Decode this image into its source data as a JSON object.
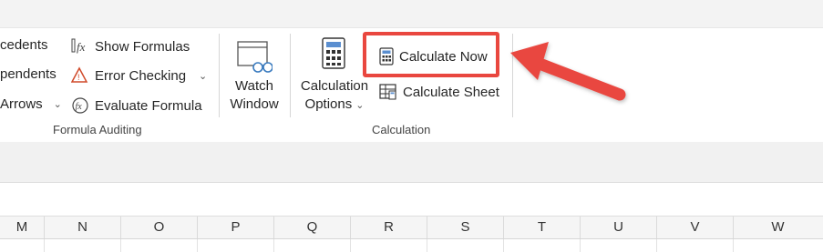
{
  "ribbon": {
    "formula_auditing": {
      "items": {
        "trace_precedents": "cedents",
        "trace_dependents": "pendents",
        "remove_arrows": "Arrows",
        "show_formulas": "Show Formulas",
        "error_checking": "Error Checking",
        "evaluate_formula": "Evaluate Formula"
      },
      "label": "Formula Auditing"
    },
    "watch_window": {
      "line1": "Watch",
      "line2": "Window"
    },
    "calculation": {
      "options_line1": "Calculation",
      "options_line2": "Options",
      "calculate_now": "Calculate Now",
      "calculate_sheet": "Calculate Sheet",
      "label": "Calculation"
    }
  },
  "columns": [
    "M",
    "N",
    "O",
    "P",
    "Q",
    "R",
    "S",
    "T",
    "U",
    "V",
    "W"
  ],
  "colors": {
    "highlight": "#e9473f",
    "arrow": "#e9473f"
  }
}
